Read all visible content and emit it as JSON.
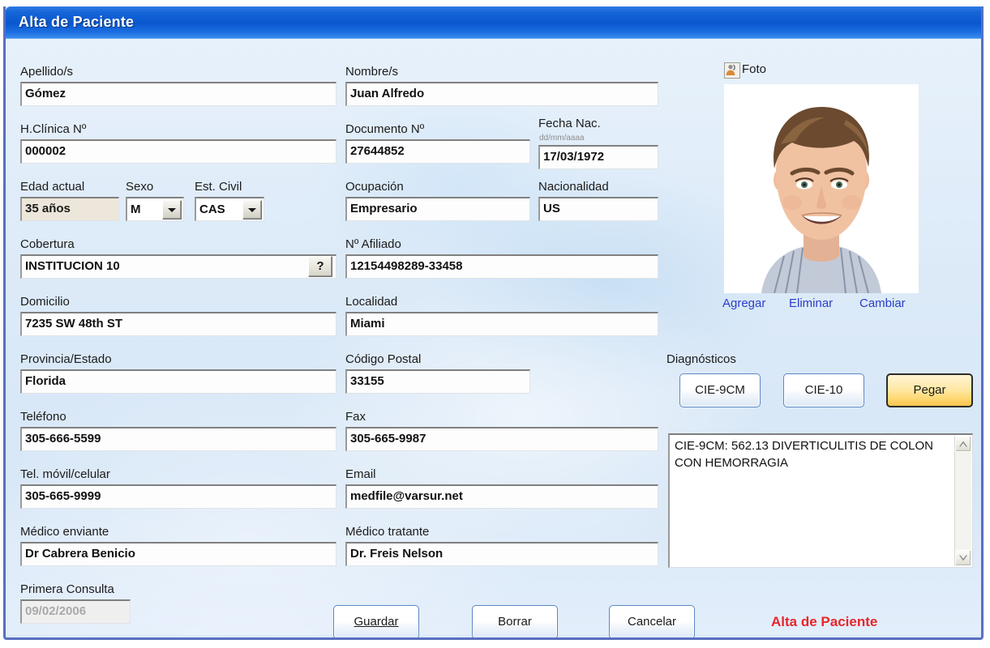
{
  "window": {
    "title": "Alta de Paciente"
  },
  "fields": {
    "apellidos": {
      "label": "Apellido/s",
      "value": "Gómez"
    },
    "nombres": {
      "label": "Nombre/s",
      "value": "Juan Alfredo"
    },
    "hclinica": {
      "label": "H.Clínica Nº",
      "value": "000002"
    },
    "documento": {
      "label": "Documento Nº",
      "value": "27644852"
    },
    "fecha_nac": {
      "label": "Fecha Nac.",
      "hint": "dd/mm/aaaa",
      "value": "17/03/1972"
    },
    "edad_actual": {
      "label": "Edad actual",
      "value": "35 años"
    },
    "sexo": {
      "label": "Sexo",
      "value": "M"
    },
    "est_civil": {
      "label": "Est. Civil",
      "value": "CAS"
    },
    "ocupacion": {
      "label": "Ocupación",
      "value": "Empresario"
    },
    "nacionalidad": {
      "label": "Nacionalidad",
      "value": "US"
    },
    "cobertura": {
      "label": "Cobertura",
      "value": "INSTITUCION 10",
      "help_button": "?"
    },
    "afiliado": {
      "label": "Nº Afiliado",
      "value": "12154498289-33458"
    },
    "domicilio": {
      "label": "Domicilio",
      "value": "7235 SW 48th ST"
    },
    "localidad": {
      "label": "Localidad",
      "value": "Miami"
    },
    "provincia": {
      "label": "Provincia/Estado",
      "value": "Florida"
    },
    "codigo_postal": {
      "label": "Código Postal",
      "value": "33155"
    },
    "telefono": {
      "label": "Teléfono",
      "value": "305-666-5599"
    },
    "fax": {
      "label": "Fax",
      "value": "305-665-9987"
    },
    "movil": {
      "label": "Tel. móvil/celular",
      "value": "305-665-9999"
    },
    "email": {
      "label": "Email",
      "value": "medfile@varsur.net"
    },
    "medico_enviante": {
      "label": "Médico enviante",
      "value": "Dr Cabrera Benicio"
    },
    "medico_tratante": {
      "label": "Médico tratante",
      "value": "Dr. Freis Nelson"
    },
    "primera_consulta": {
      "label": "Primera Consulta",
      "value": "09/02/2006"
    }
  },
  "photo": {
    "label": "Foto",
    "icon": "contact-photo-icon",
    "links": [
      {
        "label": "Agregar"
      },
      {
        "label": "Eliminar"
      },
      {
        "label": "Cambiar"
      }
    ]
  },
  "diagnostics": {
    "label": "Diagnósticos",
    "buttons": [
      {
        "label": "CIE-9CM",
        "style": "normal"
      },
      {
        "label": "CIE-10",
        "style": "normal"
      },
      {
        "label": "Pegar",
        "style": "accent"
      }
    ],
    "text": "CIE-9CM: 562.13 DIVERTICULITIS DE COLON CON HEMORRAGIA"
  },
  "actions": {
    "save": "Guardar",
    "clear": "Borrar",
    "cancel": "Cancelar"
  },
  "status": {
    "text": "Alta de Paciente",
    "color": "#e8262a"
  }
}
